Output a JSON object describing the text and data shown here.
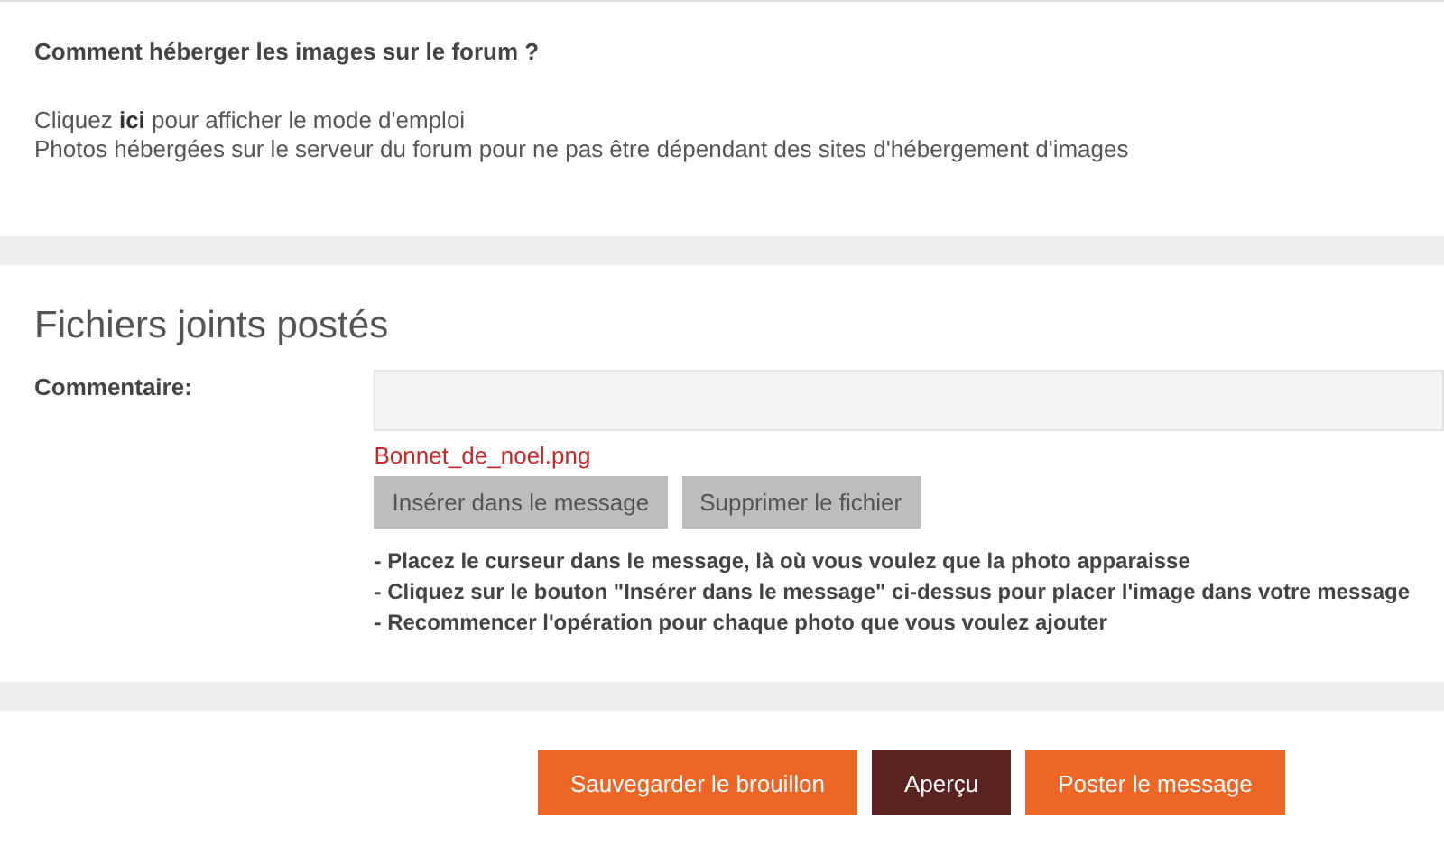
{
  "help": {
    "title": "Comment héberger les images sur le forum ?",
    "lines": [
      "Cliquez **ici** pour afficher le mode d'emploi",
      "Photos hébergées sur le serveur du forum pour ne pas être dépendant des sites d'hébergement d'images"
    ]
  },
  "attachments": {
    "title": "Fichiers joints postés",
    "comment_label": "Commentaire:",
    "file_name": "Bonnet_de_noel.png",
    "file_buttons": [
      {
        "label": "Insérer dans le message",
        "disabled": true
      },
      {
        "label": "Supprimer le fichier",
        "disabled": true
      }
    ],
    "instructions": [
      "- Placez le curseur dans le message, là où vous voulez que la photo apparaisse",
      "- Cliquez sur le bouton \"Insérer dans le message\" ci-dessus pour placer l'image dans votre message",
      "- Recommencer l'opération pour chaque photo que vous voulez ajouter"
    ]
  },
  "actions": [
    {
      "label": "Sauvegarder le brouillon",
      "kind": "primary"
    },
    {
      "label": "Aperçu",
      "kind": "secondary"
    },
    {
      "label": "Poster le message",
      "kind": "primary"
    }
  ]
}
